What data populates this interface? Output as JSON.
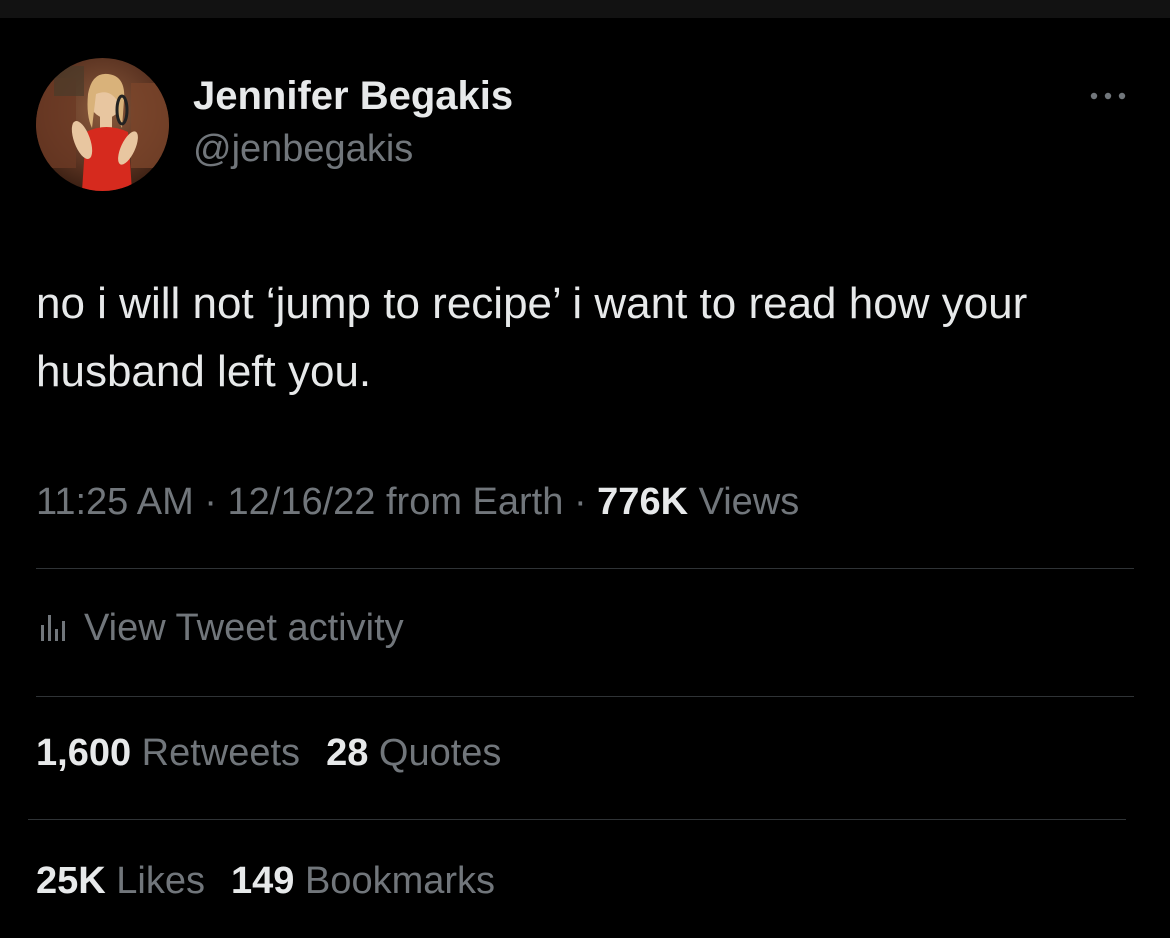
{
  "user": {
    "display_name": "Jennifer Begakis",
    "handle": "@jenbegakis"
  },
  "tweet": {
    "text": "no i will not ‘jump to recipe’ i want to read how your husband left you."
  },
  "meta": {
    "time": "11:25 AM",
    "sep1": " · ",
    "date": "12/16/22",
    "source": " from Earth",
    "sep2": " · ",
    "views_count": "776K",
    "views_label": " Views"
  },
  "activity": {
    "label": "View Tweet activity"
  },
  "stats": {
    "retweets_count": "1,600",
    "retweets_label": " Retweets",
    "quotes_count": "28",
    "quotes_label": " Quotes",
    "likes_count": "25K",
    "likes_label": " Likes",
    "bookmarks_count": "149",
    "bookmarks_label": " Bookmarks"
  },
  "icons": {
    "more": "more-options-icon",
    "activity": "bar-chart-icon"
  },
  "colors": {
    "background": "#000000",
    "primary_text": "#e7e9ea",
    "secondary_text": "#71767b",
    "divider": "#2f3336"
  }
}
